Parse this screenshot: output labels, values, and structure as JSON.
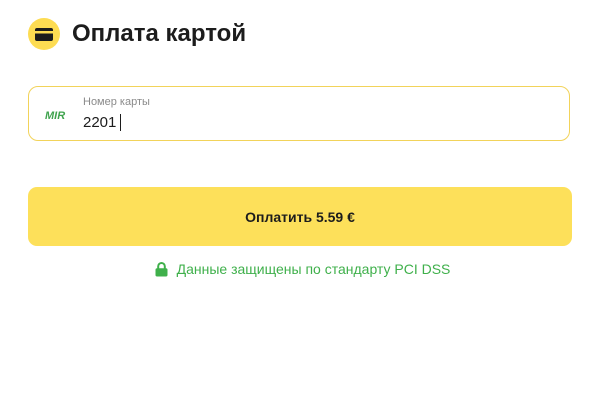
{
  "header": {
    "icon": "card-icon",
    "title": "Оплата картой"
  },
  "card_field": {
    "brand_icon": "mir-logo-icon",
    "label": "Номер карты",
    "value": "2201"
  },
  "pay_button": {
    "label": "Оплатить 5.59 €"
  },
  "security": {
    "icon": "lock-icon",
    "text": "Данные защищены по стандарту PCI DSS"
  },
  "colors": {
    "accent": "#fde05a",
    "field_border": "#f2d35a",
    "secure_green": "#3fb04b",
    "text": "#1c1c1c"
  }
}
